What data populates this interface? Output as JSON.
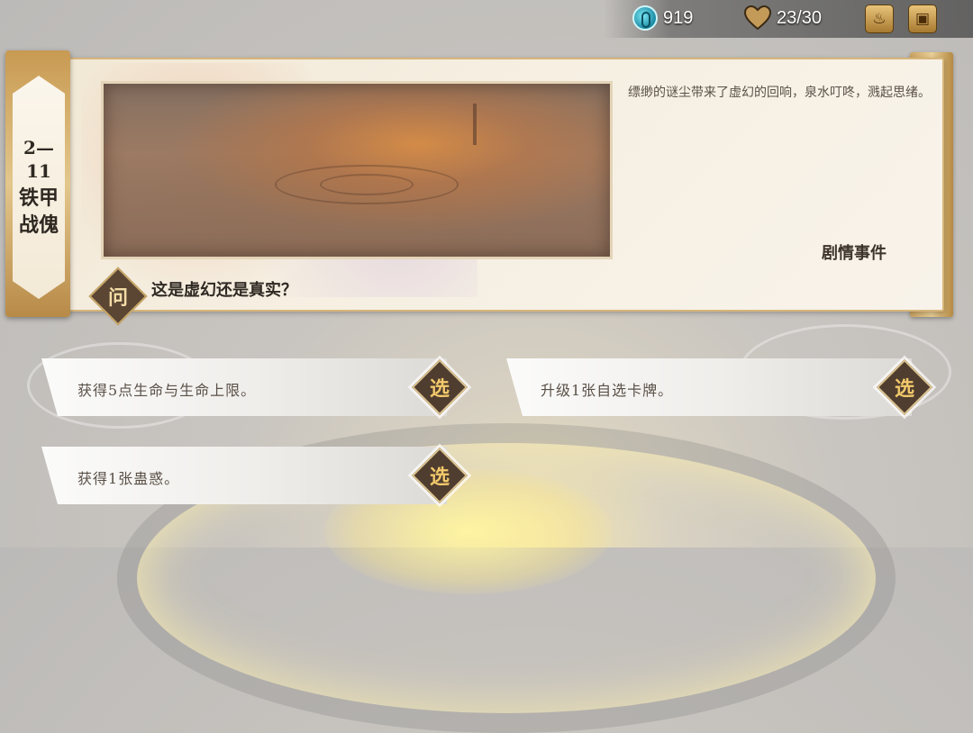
{
  "topbar": {
    "currency_icon": "spiral-coin-icon",
    "currency_value": "919",
    "hp_icon": "heart-icon",
    "hp_value": "23/30",
    "buttons": [
      {
        "icon": "flame-icon"
      },
      {
        "icon": "backpack-icon"
      }
    ]
  },
  "stage": {
    "number": "2—11",
    "name": "铁甲战傀"
  },
  "event": {
    "description": "缥缈的谜尘带来了虚幻的回响，泉水叮咚，溅起思绪。",
    "type": "剧情事件",
    "question_badge": "问",
    "question": "这是虚幻还是真实？"
  },
  "options": [
    {
      "text": "获得5点生命与生命上限。",
      "select_label": "选"
    },
    {
      "text": "升级1张自选卡牌。",
      "select_label": "选"
    },
    {
      "text": "获得1张蛊惑。",
      "select_label": "选"
    }
  ]
}
